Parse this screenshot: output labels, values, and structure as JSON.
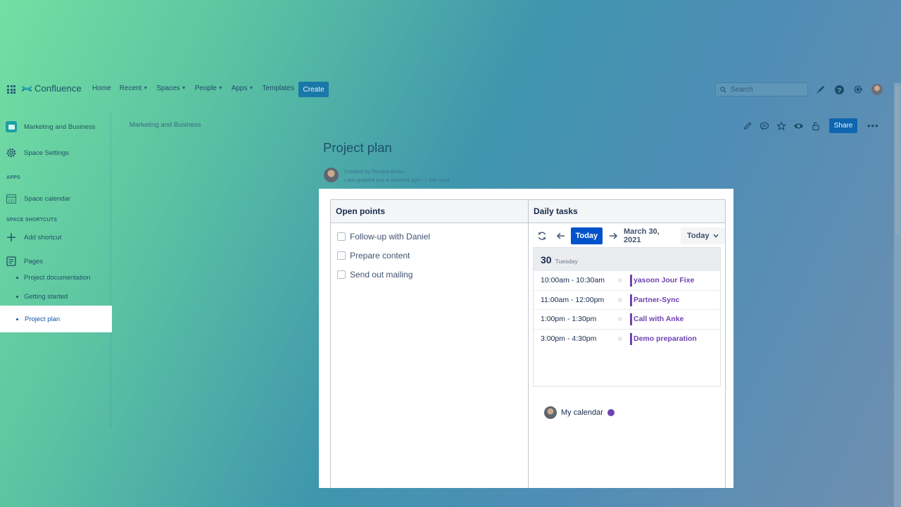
{
  "topnav": {
    "logo": "Confluence",
    "links": [
      "Home",
      "Recent",
      "Spaces",
      "People",
      "Apps",
      "Templates"
    ],
    "create_label": "Create",
    "search_placeholder": "Search"
  },
  "sidebar": {
    "space_name": "Marketing and Business",
    "space_settings": "Space Settings",
    "apps_heading": "APPS",
    "space_calendar": "Space calendar",
    "shortcuts_heading": "SPACE SHORTCUTS",
    "add_shortcut": "Add shortcut",
    "pages": "Pages",
    "page_items": [
      "Project documentation",
      "Getting started"
    ],
    "active_page": "Project plan"
  },
  "page": {
    "breadcrumb": "Marketing and Business",
    "share_label": "Share",
    "title": "Project plan",
    "created_by": "Created by Tamara Braun",
    "last_updated": "Last updated just a moment ago",
    "read_time": "1 min read"
  },
  "table": {
    "left_header": "Open points",
    "right_header": "Daily tasks",
    "todos": [
      "Follow-up with Daniel",
      "Prepare content",
      "Send out mailing"
    ]
  },
  "calendar": {
    "today_button": "Today",
    "date_label": "March 30, 2021",
    "view_label": "Today",
    "day_number": "30",
    "day_name": "Tuesday",
    "events": [
      {
        "time": "10:00am - 10:30am",
        "title": "yasoon Jour Fixe"
      },
      {
        "time": "11:00am - 12:00pm",
        "title": "Partner-Sync"
      },
      {
        "time": "1:00pm - 1:30pm",
        "title": "Call with Anke"
      },
      {
        "time": "3:00pm - 4:30pm",
        "title": "Demo preparation"
      }
    ],
    "legend_label": "My calendar",
    "event_color": "#6e43b0"
  }
}
